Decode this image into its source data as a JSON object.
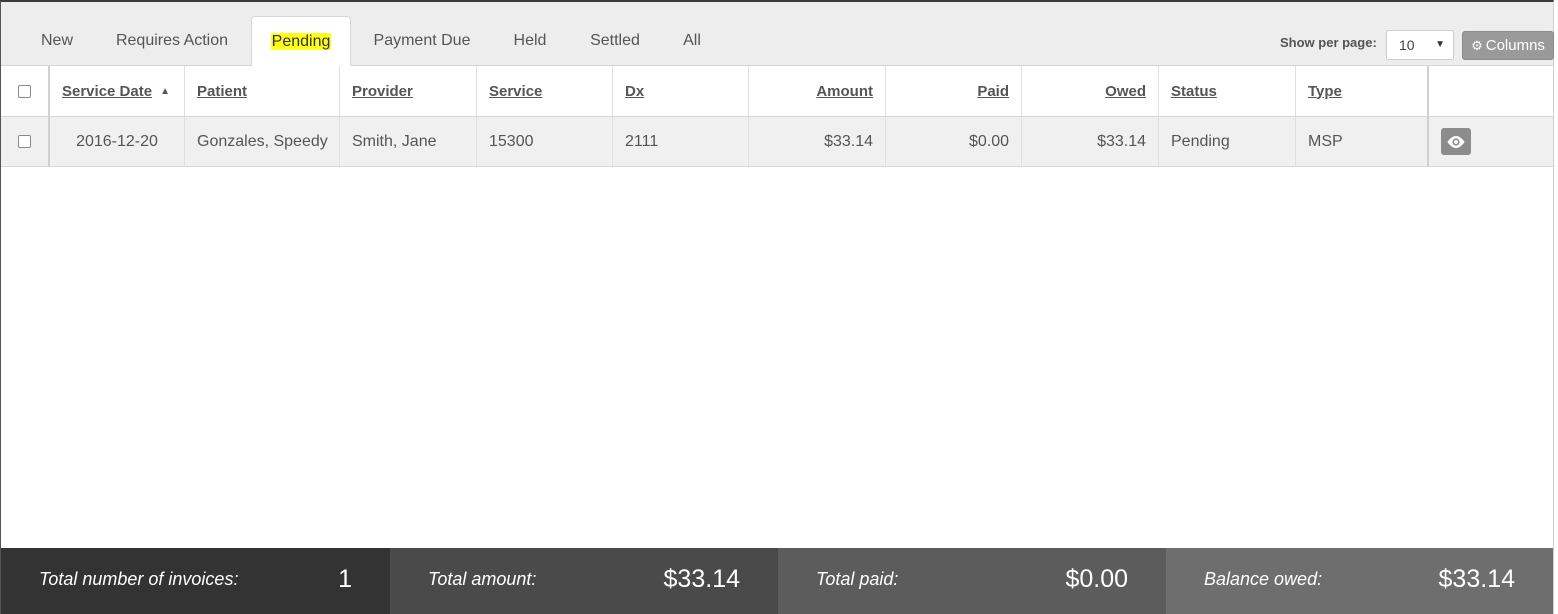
{
  "tabs": [
    {
      "label": "New"
    },
    {
      "label": "Requires Action"
    },
    {
      "label": "Pending",
      "active": true
    },
    {
      "label": "Payment Due"
    },
    {
      "label": "Held"
    },
    {
      "label": "Settled"
    },
    {
      "label": "All"
    }
  ],
  "toolbar": {
    "per_page_label": "Show per page:",
    "per_page_value": "10",
    "columns_label": "Columns"
  },
  "table": {
    "headers": {
      "service_date": "Service Date",
      "patient": "Patient",
      "provider": "Provider",
      "service": "Service",
      "dx": "Dx",
      "amount": "Amount",
      "paid": "Paid",
      "owed": "Owed",
      "status": "Status",
      "type": "Type"
    },
    "sort_column": "service_date",
    "sort_direction": "asc",
    "rows": [
      {
        "service_date": "2016-12-20",
        "patient": "Gonzales, Speedy",
        "provider": "Smith, Jane",
        "service": "15300",
        "dx": "2111",
        "amount": "$33.14",
        "paid": "$0.00",
        "owed": "$33.14",
        "status": "Pending",
        "type": "MSP"
      }
    ]
  },
  "footer": {
    "invoices_label": "Total number of invoices:",
    "invoices_value": "1",
    "amount_label": "Total amount:",
    "amount_value": "$33.14",
    "paid_label": "Total paid:",
    "paid_value": "$0.00",
    "owed_label": "Balance owed:",
    "owed_value": "$33.14"
  },
  "colors": {
    "highlight": "#ffff1a",
    "footer_1": "#333333",
    "footer_2": "#4a4a4a",
    "footer_3": "#5c5c5c",
    "footer_4": "#6e6e6e"
  }
}
